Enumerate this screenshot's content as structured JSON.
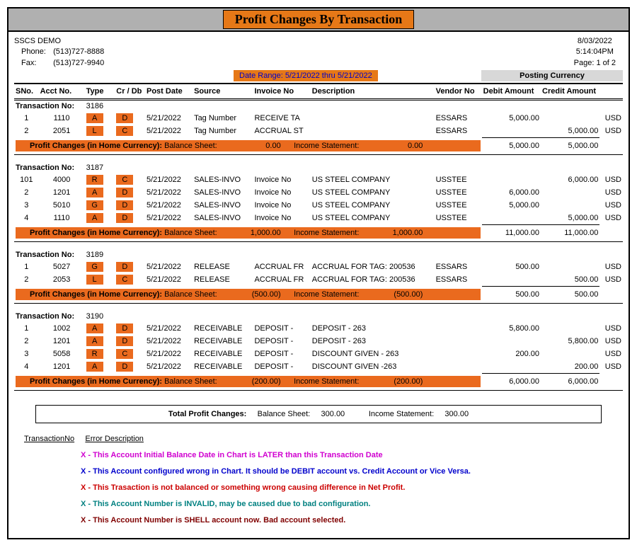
{
  "title": "Profit Changes By Transaction",
  "company": {
    "name": "SSCS DEMO",
    "phone_label": "Phone:",
    "phone": "(513)727-8888",
    "fax_label": "Fax:",
    "fax": "(513)727-9940"
  },
  "meta": {
    "date": "8/03/2022",
    "time": "5:14:04PM",
    "page": "Page: 1 of 2"
  },
  "date_range": "Date Range:  5/21/2022  thru   5/21/2022",
  "posting_currency_label": "Posting Currency",
  "columns": {
    "sno": "SNo.",
    "acct": "Acct No.",
    "type": "Type",
    "crdb": "Cr / Db",
    "post_date": "Post Date",
    "source": "Source",
    "invoice": "Invoice No",
    "desc": "Description",
    "vendor": "Vendor No",
    "debit": "Debit Amount",
    "credit": "Credit Amount"
  },
  "txn_no_label": "Transaction No:",
  "profit_label": "Profit Changes (in Home Currency):",
  "bs_label": "Balance Sheet:",
  "is_label": "Income Statement:",
  "transactions": [
    {
      "no": "3186",
      "rows": [
        {
          "sno": "1",
          "acct": "1110",
          "type": "A",
          "crdb": "D",
          "date": "5/21/2022",
          "source": "Tag Number",
          "invoice": "RECEIVE TA",
          "desc": "",
          "vendor": "ESSARS",
          "debit": "5,000.00",
          "credit": "",
          "cur": "USD"
        },
        {
          "sno": "2",
          "acct": "2051",
          "type": "L",
          "crdb": "C",
          "date": "5/21/2022",
          "source": "Tag Number",
          "invoice": "ACCRUAL ST",
          "desc": "",
          "vendor": "ESSARS",
          "debit": "",
          "credit": "5,000.00",
          "cur": "USD"
        }
      ],
      "profit": {
        "bs": "0.00",
        "is": "0.00"
      },
      "subtotal": {
        "debit": "5,000.00",
        "credit": "5,000.00"
      }
    },
    {
      "no": "3187",
      "rows": [
        {
          "sno": "101",
          "acct": "4000",
          "type": "R",
          "crdb": "C",
          "date": "5/21/2022",
          "source": "SALES-INVO",
          "invoice": "Invoice No",
          "desc": "US STEEL COMPANY",
          "vendor": "USSTEE",
          "debit": "",
          "credit": "6,000.00",
          "cur": "USD"
        },
        {
          "sno": "2",
          "acct": "1201",
          "type": "A",
          "crdb": "D",
          "date": "5/21/2022",
          "source": "SALES-INVO",
          "invoice": "Invoice No",
          "desc": "US STEEL COMPANY",
          "vendor": "USSTEE",
          "debit": "6,000.00",
          "credit": "",
          "cur": "USD"
        },
        {
          "sno": "3",
          "acct": "5010",
          "type": "G",
          "crdb": "D",
          "date": "5/21/2022",
          "source": "SALES-INVO",
          "invoice": "Invoice No",
          "desc": "US STEEL COMPANY",
          "vendor": "USSTEE",
          "debit": "5,000.00",
          "credit": "",
          "cur": "USD"
        },
        {
          "sno": "4",
          "acct": "1110",
          "type": "A",
          "crdb": "D",
          "date": "5/21/2022",
          "source": "SALES-INVO",
          "invoice": "Invoice No",
          "desc": "US STEEL COMPANY",
          "vendor": "USSTEE",
          "debit": "",
          "credit": "5,000.00",
          "cur": "USD"
        }
      ],
      "profit": {
        "bs": "1,000.00",
        "is": "1,000.00"
      },
      "subtotal": {
        "debit": "11,000.00",
        "credit": "11,000.00"
      }
    },
    {
      "no": "3189",
      "rows": [
        {
          "sno": "1",
          "acct": "5027",
          "type": "G",
          "crdb": "D",
          "date": "5/21/2022",
          "source": "RELEASE",
          "invoice": "ACCRUAL FR",
          "desc": "ACCRUAL FOR TAG: 200536",
          "vendor": "ESSARS",
          "debit": "500.00",
          "credit": "",
          "cur": "USD"
        },
        {
          "sno": "2",
          "acct": "2053",
          "type": "L",
          "crdb": "C",
          "date": "5/21/2022",
          "source": "RELEASE",
          "invoice": "ACCRUAL FR",
          "desc": "ACCRUAL FOR TAG: 200536",
          "vendor": "ESSARS",
          "debit": "",
          "credit": "500.00",
          "cur": "USD"
        }
      ],
      "profit": {
        "bs": "(500.00)",
        "is": "(500.00)"
      },
      "subtotal": {
        "debit": "500.00",
        "credit": "500.00"
      }
    },
    {
      "no": "3190",
      "rows": [
        {
          "sno": "1",
          "acct": "1002",
          "type": "A",
          "crdb": "D",
          "date": "5/21/2022",
          "source": "RECEIVABLE",
          "invoice": "DEPOSIT  -",
          "desc": "DEPOSIT  - 263",
          "vendor": "",
          "debit": "5,800.00",
          "credit": "",
          "cur": "USD"
        },
        {
          "sno": "2",
          "acct": "1201",
          "type": "A",
          "crdb": "D",
          "date": "5/21/2022",
          "source": "RECEIVABLE",
          "invoice": "DEPOSIT  -",
          "desc": "DEPOSIT  - 263",
          "vendor": "",
          "debit": "",
          "credit": "5,800.00",
          "cur": "USD"
        },
        {
          "sno": "3",
          "acct": "5058",
          "type": "R",
          "crdb": "C",
          "date": "5/21/2022",
          "source": "RECEIVABLE",
          "invoice": "DEPOSIT  -",
          "desc": "DISCOUNT GIVEN - 263",
          "vendor": "",
          "debit": "200.00",
          "credit": "",
          "cur": "USD"
        },
        {
          "sno": "4",
          "acct": "1201",
          "type": "A",
          "crdb": "D",
          "date": "5/21/2022",
          "source": "RECEIVABLE",
          "invoice": "DEPOSIT  -",
          "desc": "DISCOUNT GIVEN -263",
          "vendor": "",
          "debit": "",
          "credit": "200.00",
          "cur": "USD"
        }
      ],
      "profit": {
        "bs": "(200.00)",
        "is": "(200.00)"
      },
      "subtotal": {
        "debit": "6,000.00",
        "credit": "6,000.00"
      }
    }
  ],
  "grand_total": {
    "label": "Total Profit Changes:",
    "bs_label": "Balance Sheet:",
    "bs": "300.00",
    "is_label": "Income Statement:",
    "is": "300.00"
  },
  "legend": {
    "h1": "TransactionNo",
    "h2": "Error Description",
    "rows": [
      {
        "cls": "magenta",
        "text": "X - This Account Initial Balance Date in Chart is LATER than this Transaction Date"
      },
      {
        "cls": "blue",
        "text": "X - This Account configured wrong in Chart. It should be DEBIT account vs. Credit Account or Vice Versa."
      },
      {
        "cls": "red",
        "text": "X - This Trasaction is not balanced or something wrong causing difference in Net Profit."
      },
      {
        "cls": "teal",
        "text": "X - This Account Number is INVALID, may be caused due to bad configuration."
      },
      {
        "cls": "maroon",
        "text": "X - This Account Number is SHELL account now. Bad account selected."
      }
    ]
  }
}
